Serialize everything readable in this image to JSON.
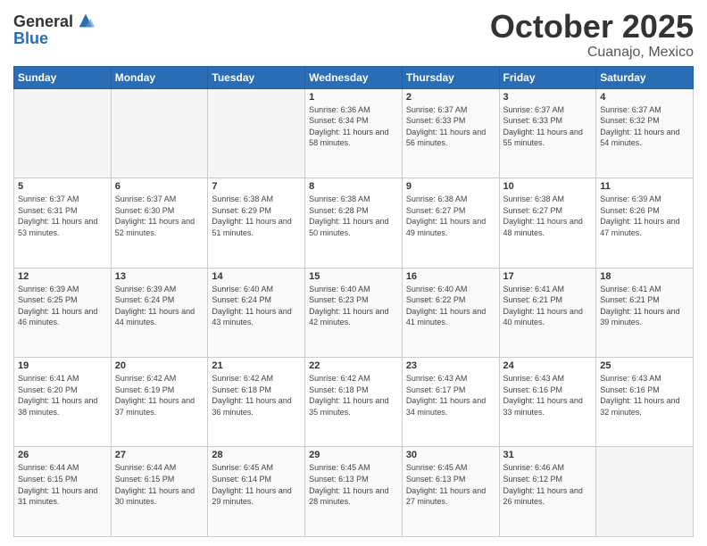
{
  "header": {
    "logo_general": "General",
    "logo_blue": "Blue",
    "month": "October 2025",
    "location": "Cuanajo, Mexico"
  },
  "days_of_week": [
    "Sunday",
    "Monday",
    "Tuesday",
    "Wednesday",
    "Thursday",
    "Friday",
    "Saturday"
  ],
  "weeks": [
    [
      {
        "day": "",
        "sunrise": "",
        "sunset": "",
        "daylight": ""
      },
      {
        "day": "",
        "sunrise": "",
        "sunset": "",
        "daylight": ""
      },
      {
        "day": "",
        "sunrise": "",
        "sunset": "",
        "daylight": ""
      },
      {
        "day": "1",
        "sunrise": "Sunrise: 6:36 AM",
        "sunset": "Sunset: 6:34 PM",
        "daylight": "Daylight: 11 hours and 58 minutes."
      },
      {
        "day": "2",
        "sunrise": "Sunrise: 6:37 AM",
        "sunset": "Sunset: 6:33 PM",
        "daylight": "Daylight: 11 hours and 56 minutes."
      },
      {
        "day": "3",
        "sunrise": "Sunrise: 6:37 AM",
        "sunset": "Sunset: 6:33 PM",
        "daylight": "Daylight: 11 hours and 55 minutes."
      },
      {
        "day": "4",
        "sunrise": "Sunrise: 6:37 AM",
        "sunset": "Sunset: 6:32 PM",
        "daylight": "Daylight: 11 hours and 54 minutes."
      }
    ],
    [
      {
        "day": "5",
        "sunrise": "Sunrise: 6:37 AM",
        "sunset": "Sunset: 6:31 PM",
        "daylight": "Daylight: 11 hours and 53 minutes."
      },
      {
        "day": "6",
        "sunrise": "Sunrise: 6:37 AM",
        "sunset": "Sunset: 6:30 PM",
        "daylight": "Daylight: 11 hours and 52 minutes."
      },
      {
        "day": "7",
        "sunrise": "Sunrise: 6:38 AM",
        "sunset": "Sunset: 6:29 PM",
        "daylight": "Daylight: 11 hours and 51 minutes."
      },
      {
        "day": "8",
        "sunrise": "Sunrise: 6:38 AM",
        "sunset": "Sunset: 6:28 PM",
        "daylight": "Daylight: 11 hours and 50 minutes."
      },
      {
        "day": "9",
        "sunrise": "Sunrise: 6:38 AM",
        "sunset": "Sunset: 6:27 PM",
        "daylight": "Daylight: 11 hours and 49 minutes."
      },
      {
        "day": "10",
        "sunrise": "Sunrise: 6:38 AM",
        "sunset": "Sunset: 6:27 PM",
        "daylight": "Daylight: 11 hours and 48 minutes."
      },
      {
        "day": "11",
        "sunrise": "Sunrise: 6:39 AM",
        "sunset": "Sunset: 6:26 PM",
        "daylight": "Daylight: 11 hours and 47 minutes."
      }
    ],
    [
      {
        "day": "12",
        "sunrise": "Sunrise: 6:39 AM",
        "sunset": "Sunset: 6:25 PM",
        "daylight": "Daylight: 11 hours and 46 minutes."
      },
      {
        "day": "13",
        "sunrise": "Sunrise: 6:39 AM",
        "sunset": "Sunset: 6:24 PM",
        "daylight": "Daylight: 11 hours and 44 minutes."
      },
      {
        "day": "14",
        "sunrise": "Sunrise: 6:40 AM",
        "sunset": "Sunset: 6:24 PM",
        "daylight": "Daylight: 11 hours and 43 minutes."
      },
      {
        "day": "15",
        "sunrise": "Sunrise: 6:40 AM",
        "sunset": "Sunset: 6:23 PM",
        "daylight": "Daylight: 11 hours and 42 minutes."
      },
      {
        "day": "16",
        "sunrise": "Sunrise: 6:40 AM",
        "sunset": "Sunset: 6:22 PM",
        "daylight": "Daylight: 11 hours and 41 minutes."
      },
      {
        "day": "17",
        "sunrise": "Sunrise: 6:41 AM",
        "sunset": "Sunset: 6:21 PM",
        "daylight": "Daylight: 11 hours and 40 minutes."
      },
      {
        "day": "18",
        "sunrise": "Sunrise: 6:41 AM",
        "sunset": "Sunset: 6:21 PM",
        "daylight": "Daylight: 11 hours and 39 minutes."
      }
    ],
    [
      {
        "day": "19",
        "sunrise": "Sunrise: 6:41 AM",
        "sunset": "Sunset: 6:20 PM",
        "daylight": "Daylight: 11 hours and 38 minutes."
      },
      {
        "day": "20",
        "sunrise": "Sunrise: 6:42 AM",
        "sunset": "Sunset: 6:19 PM",
        "daylight": "Daylight: 11 hours and 37 minutes."
      },
      {
        "day": "21",
        "sunrise": "Sunrise: 6:42 AM",
        "sunset": "Sunset: 6:18 PM",
        "daylight": "Daylight: 11 hours and 36 minutes."
      },
      {
        "day": "22",
        "sunrise": "Sunrise: 6:42 AM",
        "sunset": "Sunset: 6:18 PM",
        "daylight": "Daylight: 11 hours and 35 minutes."
      },
      {
        "day": "23",
        "sunrise": "Sunrise: 6:43 AM",
        "sunset": "Sunset: 6:17 PM",
        "daylight": "Daylight: 11 hours and 34 minutes."
      },
      {
        "day": "24",
        "sunrise": "Sunrise: 6:43 AM",
        "sunset": "Sunset: 6:16 PM",
        "daylight": "Daylight: 11 hours and 33 minutes."
      },
      {
        "day": "25",
        "sunrise": "Sunrise: 6:43 AM",
        "sunset": "Sunset: 6:16 PM",
        "daylight": "Daylight: 11 hours and 32 minutes."
      }
    ],
    [
      {
        "day": "26",
        "sunrise": "Sunrise: 6:44 AM",
        "sunset": "Sunset: 6:15 PM",
        "daylight": "Daylight: 11 hours and 31 minutes."
      },
      {
        "day": "27",
        "sunrise": "Sunrise: 6:44 AM",
        "sunset": "Sunset: 6:15 PM",
        "daylight": "Daylight: 11 hours and 30 minutes."
      },
      {
        "day": "28",
        "sunrise": "Sunrise: 6:45 AM",
        "sunset": "Sunset: 6:14 PM",
        "daylight": "Daylight: 11 hours and 29 minutes."
      },
      {
        "day": "29",
        "sunrise": "Sunrise: 6:45 AM",
        "sunset": "Sunset: 6:13 PM",
        "daylight": "Daylight: 11 hours and 28 minutes."
      },
      {
        "day": "30",
        "sunrise": "Sunrise: 6:45 AM",
        "sunset": "Sunset: 6:13 PM",
        "daylight": "Daylight: 11 hours and 27 minutes."
      },
      {
        "day": "31",
        "sunrise": "Sunrise: 6:46 AM",
        "sunset": "Sunset: 6:12 PM",
        "daylight": "Daylight: 11 hours and 26 minutes."
      },
      {
        "day": "",
        "sunrise": "",
        "sunset": "",
        "daylight": ""
      }
    ]
  ]
}
